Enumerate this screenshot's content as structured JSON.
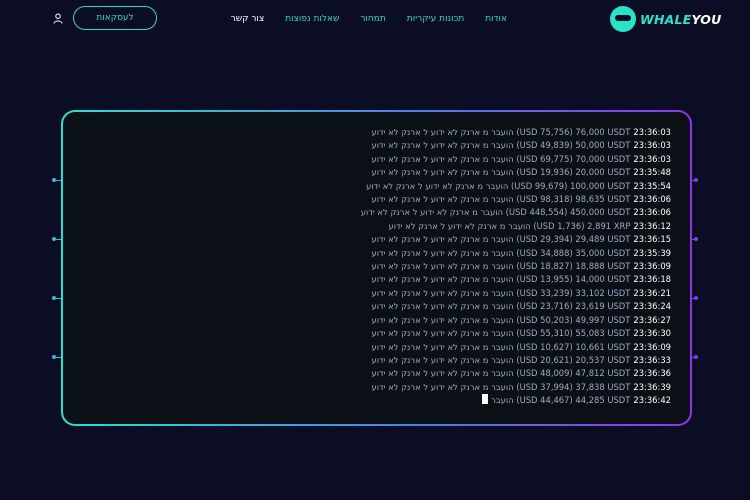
{
  "brand": {
    "part1": "WHALE",
    "part2": "YOU"
  },
  "nav": {
    "items": [
      {
        "label": "אודות"
      },
      {
        "label": "תכונות עיקריות"
      },
      {
        "label": "תמחור"
      },
      {
        "label": "שאלות נפוצות"
      },
      {
        "label": "צור קשר"
      }
    ]
  },
  "cta": {
    "label": "לעסקאות"
  },
  "colors": {
    "accent": "#2bd8c0",
    "background": "#0b0d24",
    "gradient_end": "#9333ea"
  },
  "icons": {
    "user": "user-icon",
    "logo": "whale-logo-icon"
  },
  "log": {
    "lines": [
      {
        "text": "הועבר מ ארנק לא ידוע ל ארנק לא ידוע (USD 75,756) 76,000 USDT",
        "time": "23:36:03"
      },
      {
        "text": "הועבר מ ארנק לא ידוע ל ארנק לא ידוע (USD 49,839) 50,000 USDT",
        "time": "23:36:03"
      },
      {
        "text": "הועבר מ ארנק לא ידוע ל ארנק לא ידוע (USD 69,775) 70,000 USDT",
        "time": "23:36:03"
      },
      {
        "text": "הועבר מ ארנק לא ידוע ל ארנק לא ידוע (USD 19,936) 20,000 USDT",
        "time": "23:35:48"
      },
      {
        "text": "הועבר מ ארנק לא ידוע ל ארנק לא ידוע (USD 99,679) 100,000 USDT",
        "time": "23:35:54"
      },
      {
        "text": "הועבר מ ארנק לא ידוע ל ארנק לא ידוע (USD 98,318) 98,635 USDT",
        "time": "23:36:06"
      },
      {
        "text": "הועבר מ ארנק לא ידוע ל ארנק לא ידוע (USD 448,554) 450,000 USDT",
        "time": "23:36:06"
      },
      {
        "text": "הועבר מ ארנק לא ידוע ל ארנק לא ידוע (USD 1,736) 2,891 XRP",
        "time": "23:36:12"
      },
      {
        "text": "הועבר מ ארנק לא ידוע ל ארנק לא ידוע (USD 29,394) 29,489 USDT",
        "time": "23:36:15"
      },
      {
        "text": "הועבר מ ארנק לא ידוע ל ארנק לא ידוע (USD 34,888) 35,000 USDT",
        "time": "23:35:39"
      },
      {
        "text": "הועבר מ ארנק לא ידוע ל ארנק לא ידוע (USD 18,827) 18,888 USDT",
        "time": "23:36:09"
      },
      {
        "text": "הועבר מ ארנק לא ידוע ל ארנק לא ידוע (USD 13,955) 14,000 USDT",
        "time": "23:36:18"
      },
      {
        "text": "הועבר מ ארנק לא ידוע ל ארנק לא ידוע (USD 33,239) 33,102 USDT",
        "time": "23:36:21"
      },
      {
        "text": "הועבר מ ארנק לא ידוע ל ארנק לא ידוע (USD 23,716) 23,619 USDT",
        "time": "23:36:24"
      },
      {
        "text": "הועבר מ ארנק לא ידוע ל ארנק לא ידוע (USD 50,203) 49,997 USDT",
        "time": "23:36:27"
      },
      {
        "text": "הועבר מ ארנק לא ידוע ל ארנק לא ידוע (USD 55,310) 55,083 USDT",
        "time": "23:36:30"
      },
      {
        "text": "הועבר מ ארנק לא ידוע ל ארנק לא ידוע (USD 10,627) 10,661 USDT",
        "time": "23:36:09"
      },
      {
        "text": "הועבר מ ארנק לא ידוע ל ארנק לא ידוע (USD 20,621) 20,537 USDT",
        "time": "23:36:33"
      },
      {
        "text": "הועבר מ ארנק לא ידוע ל ארנק לא ידוע (USD 48,009) 47,812 USDT",
        "time": "23:36:36"
      },
      {
        "text": "הועבר מ ארנק לא ידוע ל ארנק לא ידוע (USD 37,994) 37,838 USDT",
        "time": "23:36:39"
      },
      {
        "text": "הועבר (USD 44,467) 44,285 USDT",
        "time": "23:36:42",
        "typing": true
      }
    ]
  }
}
